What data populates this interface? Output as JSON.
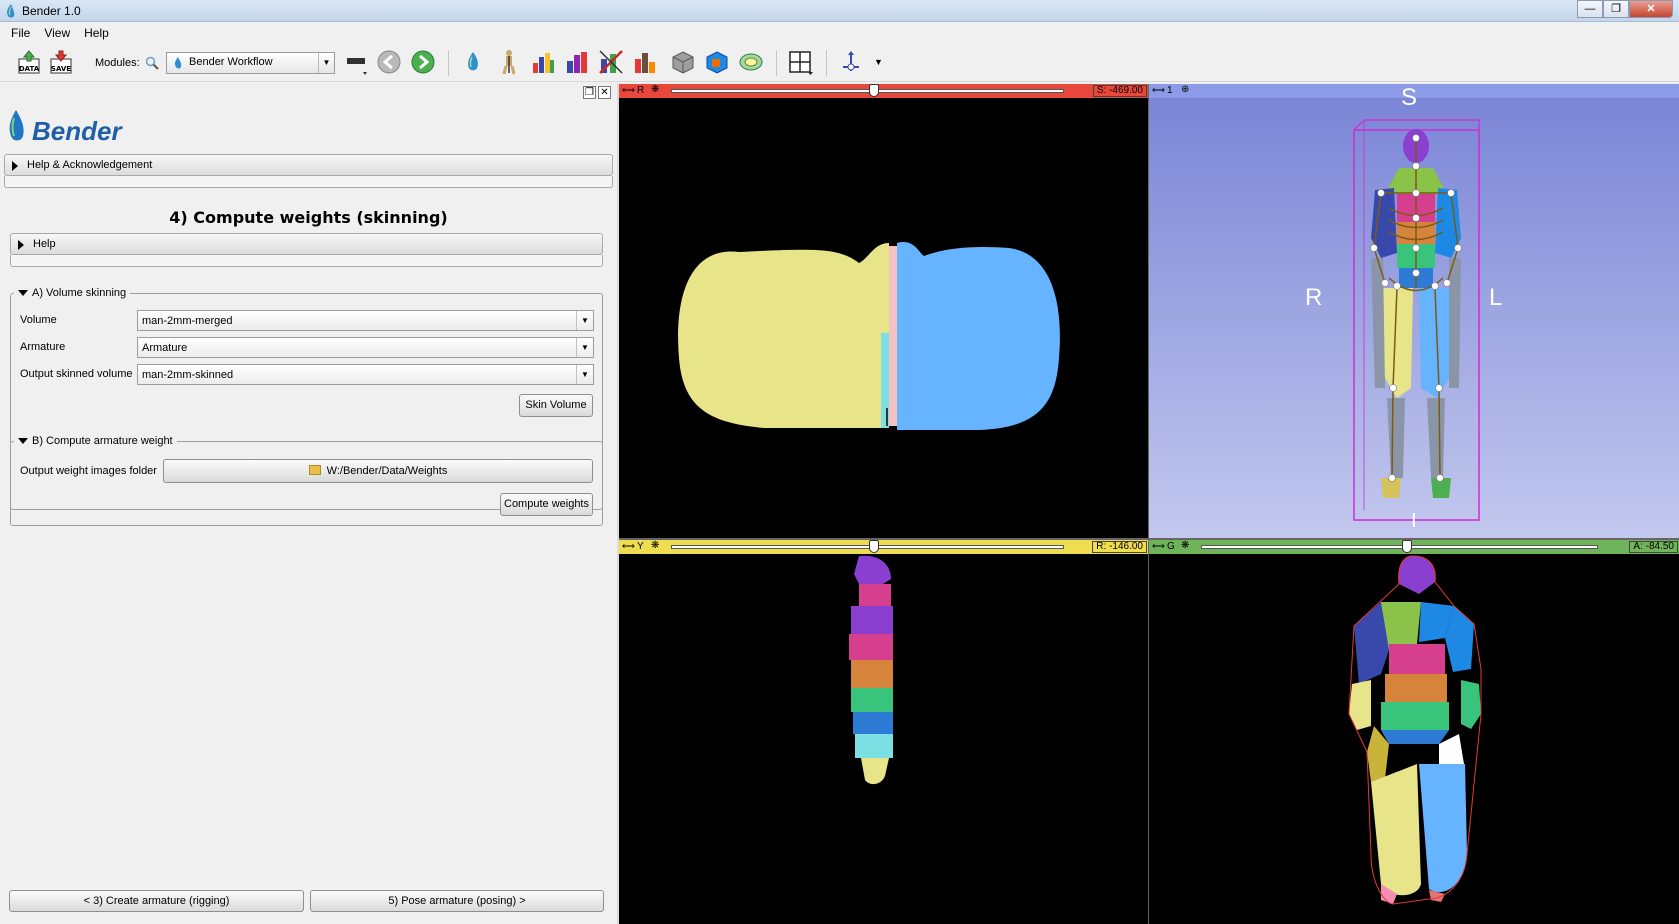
{
  "window": {
    "title": "Bender 1.0",
    "controls": [
      "minimize-icon",
      "maximize-icon",
      "close-icon"
    ]
  },
  "menubar": {
    "items": [
      "File",
      "View",
      "Help"
    ]
  },
  "toolbar": {
    "data_button": "DATA",
    "save_button": "SAVE",
    "modules_label": "Modules:",
    "module_select_value": "Bender Workflow",
    "icons": [
      "load-data-icon",
      "save-icon",
      "search-icon",
      "module-icon",
      "layout-menu-icon",
      "back-arrow-icon",
      "forward-arrow-icon",
      "bender-drop-icon",
      "armature-icon",
      "volume-skinning-icon",
      "armature-weight-icon",
      "pose-body-icon",
      "pose-labelmap-icon",
      "cube-icon",
      "model-icon",
      "segment-icon",
      "layout-grid-icon",
      "crosshair-icon"
    ]
  },
  "left_panel": {
    "logo_text": "Bender",
    "help_ack_label": "Help & Acknowledgement",
    "step_title": "4) Compute weights (skinning)",
    "help_label": "Help",
    "volume_skinning": {
      "title": "A) Volume skinning",
      "volume_label": "Volume",
      "volume_value": "man-2mm-merged",
      "armature_label": "Armature",
      "armature_value": "Armature",
      "output_label": "Output skinned volume",
      "output_value": "man-2mm-skinned",
      "skin_button": "Skin Volume"
    },
    "armature_weight": {
      "title": "B) Compute armature weight",
      "folder_label": "Output weight images folder",
      "folder_value": "W:/Bender/Data/Weights",
      "compute_button": "Compute weights"
    },
    "nav": {
      "prev_button": "< 3) Create armature (rigging)",
      "next_button": "5) Pose armature (posing) >"
    }
  },
  "views": {
    "red": {
      "label": "R",
      "offset": "S: -469.00",
      "bar_color": "#e8473b"
    },
    "threed": {
      "label": "1",
      "bar_color": "#8c9be8",
      "orientation": {
        "top": "S",
        "left": "R",
        "right": "L",
        "bottom": "I"
      }
    },
    "yellow": {
      "label": "Y",
      "offset": "R: -146.00",
      "bar_color": "#eedc51"
    },
    "green": {
      "label": "G",
      "offset": "A: -84.50",
      "bar_color": "#6fb35a"
    }
  },
  "colors": {
    "yellow_region": "#e8e48a",
    "blue_region": "#66b3ff",
    "purple_region": "#8a3fd1",
    "magenta_region": "#d63f8e",
    "orange_region": "#d6833b",
    "green_region": "#38c57b",
    "cyan_region": "#7cdfe3",
    "bg_3d_top": "#7b85d6",
    "bg_3d_bottom": "#c2c8ee"
  }
}
